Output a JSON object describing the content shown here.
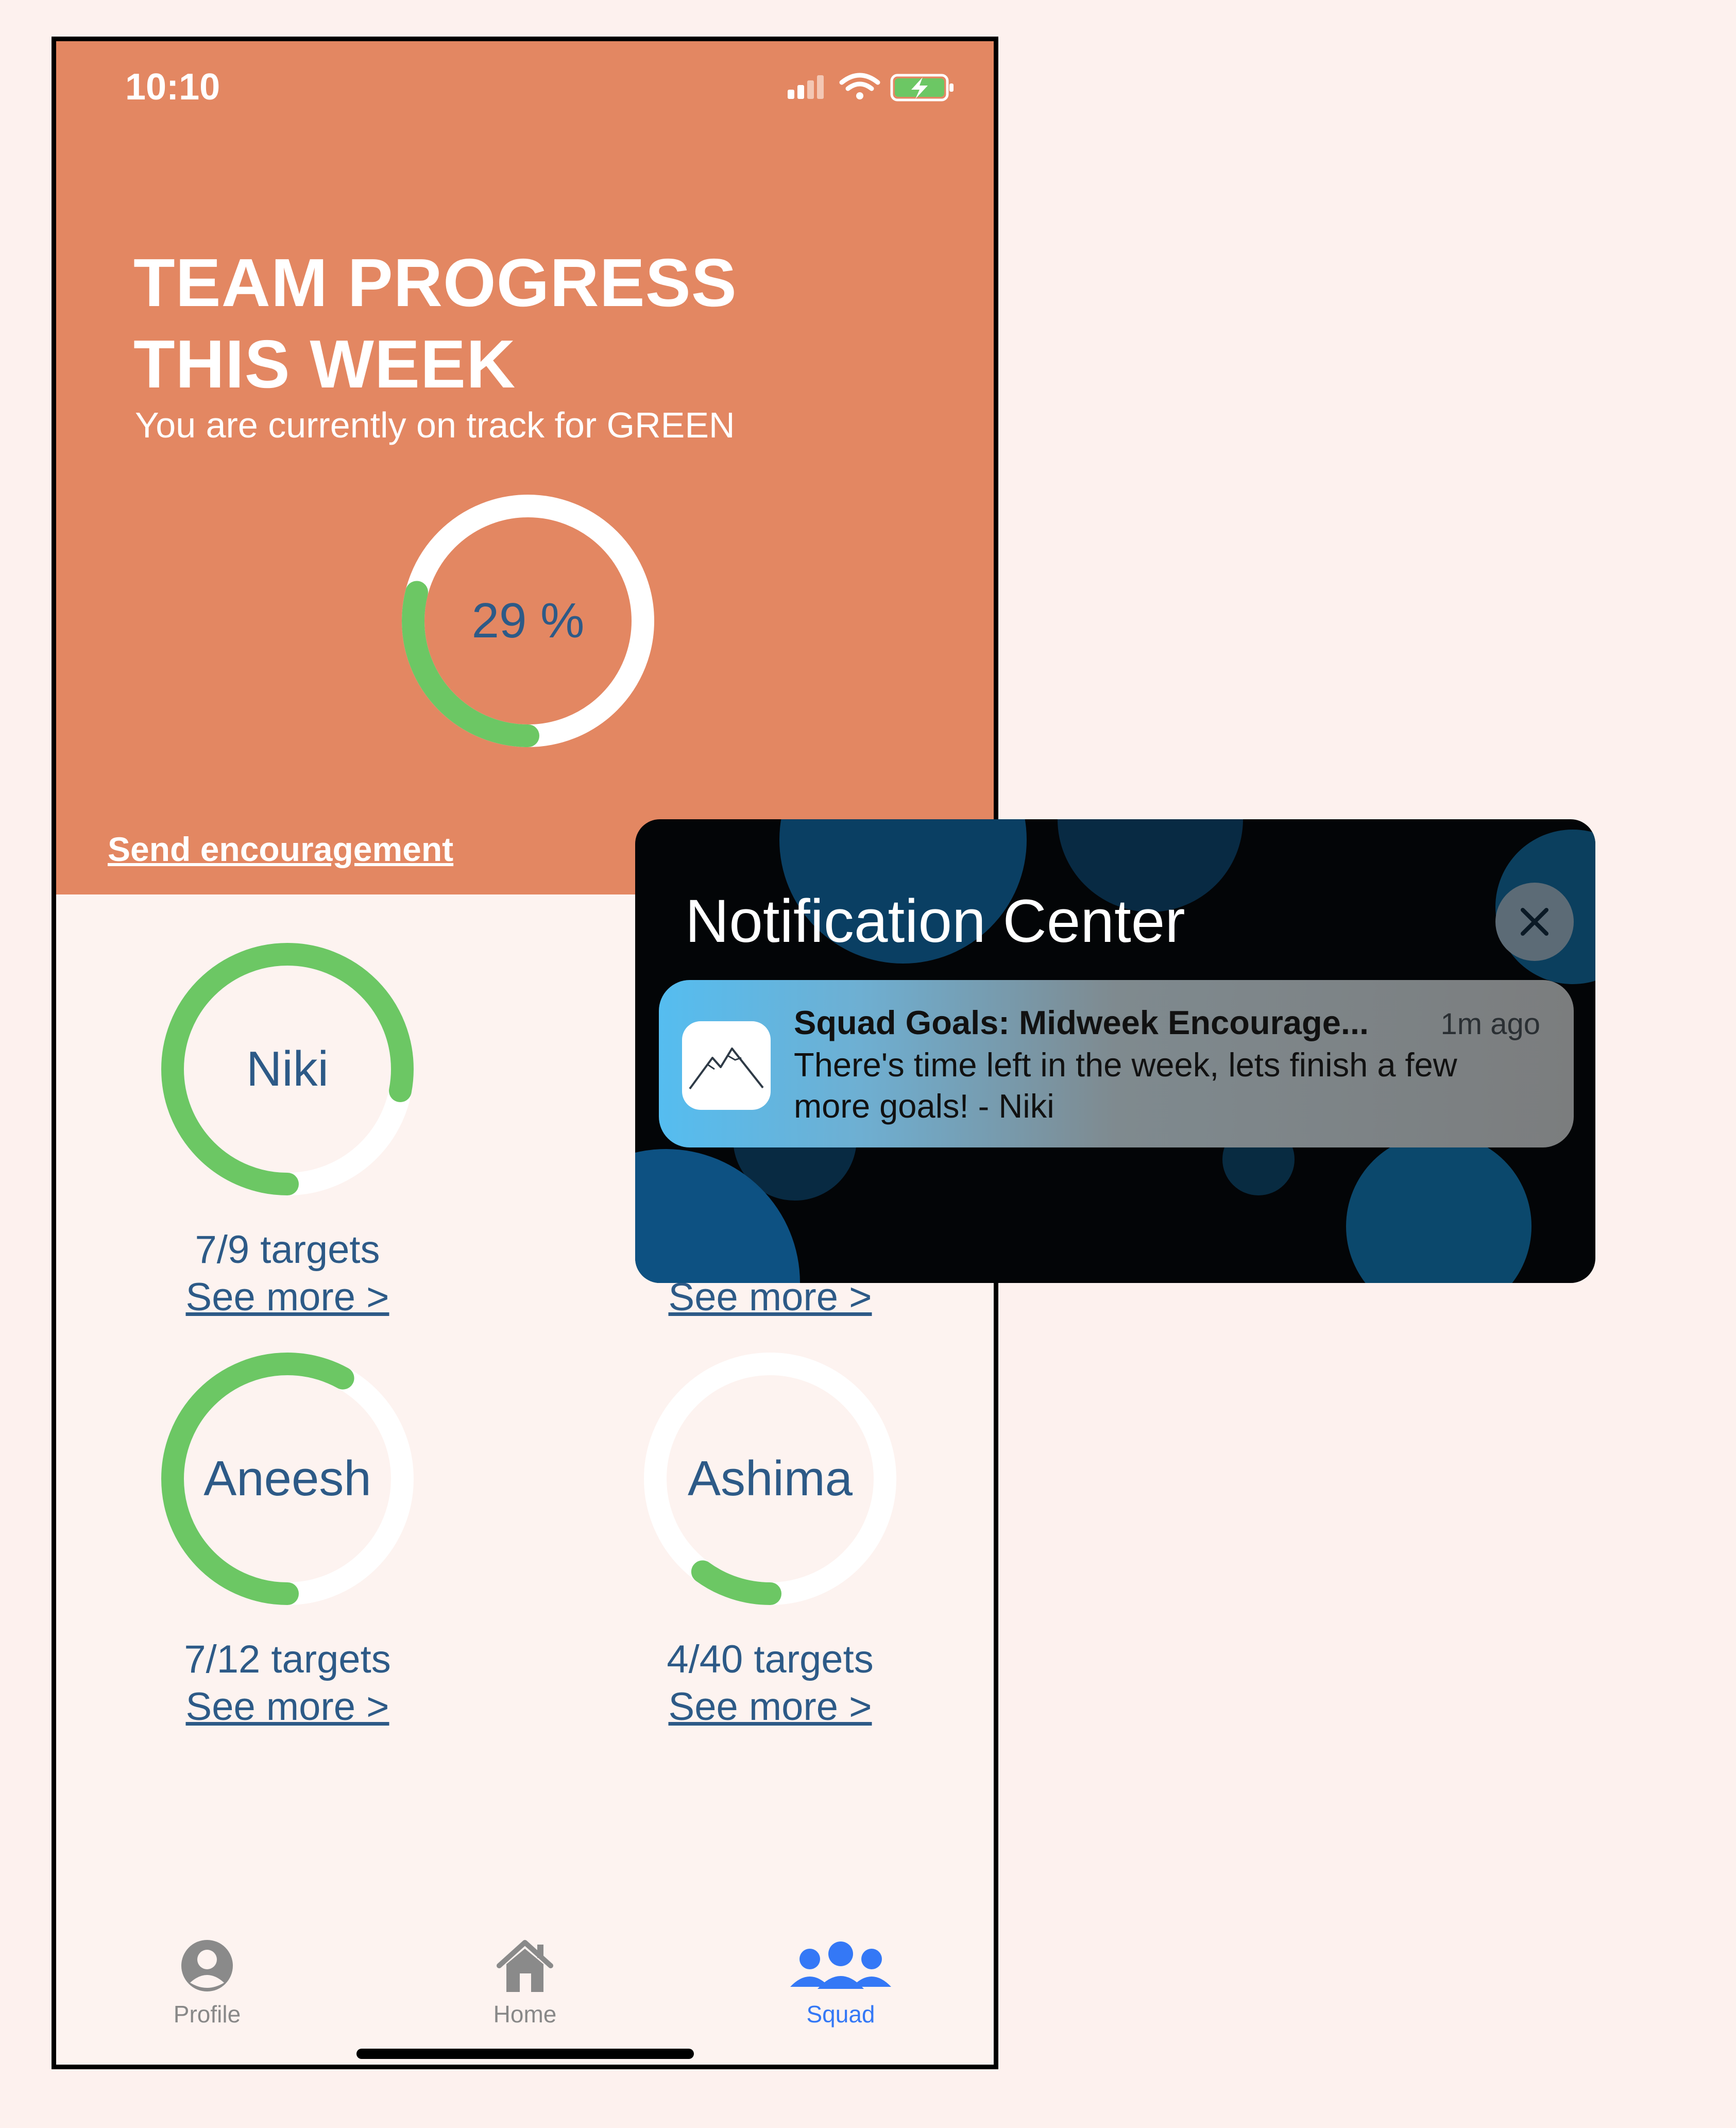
{
  "status_bar": {
    "time": "10:10",
    "icons": [
      "cellular-signal-icon",
      "wifi-icon",
      "battery-charging-icon"
    ]
  },
  "header": {
    "title_line1": "TEAM PROGRESS",
    "title_line2": "THIS WEEK",
    "subtitle": "You are currently on track for GREEN",
    "progress_label": "29 %",
    "progress_fraction": 0.29,
    "send_link": "Send encouragement"
  },
  "members": [
    {
      "name": "Niki",
      "targets": "7/9 targets",
      "see_more": "See more >",
      "progress": 0.78
    },
    {
      "name": "",
      "targets": "",
      "see_more": "See more >",
      "progress": 0
    },
    {
      "name": "Aneesh",
      "targets": "7/12 targets",
      "see_more": "See more >",
      "progress": 0.58
    },
    {
      "name": "Ashima",
      "targets": "4/40 targets",
      "see_more": "See more >",
      "progress": 0.1
    }
  ],
  "tabbar": {
    "items": [
      {
        "label": "Profile",
        "icon": "profile-icon",
        "active": false
      },
      {
        "label": "Home",
        "icon": "home-icon",
        "active": false
      },
      {
        "label": "Squad",
        "icon": "squad-icon",
        "active": true
      }
    ]
  },
  "notification_center": {
    "title": "Notification Center",
    "close_icon": "close-icon",
    "notification": {
      "app_icon": "mountain-icon",
      "title": "Squad Goals: Midweek Encourage...",
      "time": "1m ago",
      "body": "There's time left in the week, lets finish a few more goals! - Niki"
    }
  },
  "colors": {
    "header_bg": "#e38762",
    "ring_green": "#6cc764",
    "ring_track": "#ffffff",
    "text_blue": "#2d5a87",
    "tab_active": "#3478f6",
    "tab_inactive": "#888888"
  }
}
